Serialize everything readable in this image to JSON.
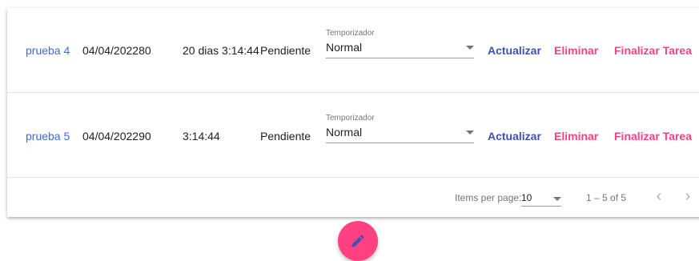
{
  "table": {
    "rows": [
      {
        "name": "prueba 4",
        "date": "04/04/202280",
        "time": "20 dias 3:14:44",
        "status": "Pendiente",
        "timer_label": "Temporizador",
        "timer_value": "Normal",
        "update_label": "Actualizar",
        "delete_label": "Eliminar",
        "finish_label": "Finalizar Tarea"
      },
      {
        "name": "prueba 5",
        "date": "04/04/202290",
        "time": "3:14:44",
        "status": "Pendiente",
        "timer_label": "Temporizador",
        "timer_value": "Normal",
        "update_label": "Actualizar",
        "delete_label": "Eliminar",
        "finish_label": "Finalizar Tarea"
      }
    ]
  },
  "paginator": {
    "items_per_page_label": "Items per page:",
    "page_size": "10",
    "range_label": "1 – 5 of 5",
    "prev_icon": "‹",
    "next_icon": "›"
  },
  "colors": {
    "link": "#3f6ae0",
    "primary": "#3f51b5",
    "accent": "#ff4081"
  },
  "fab": {
    "icon": "pencil-icon"
  }
}
